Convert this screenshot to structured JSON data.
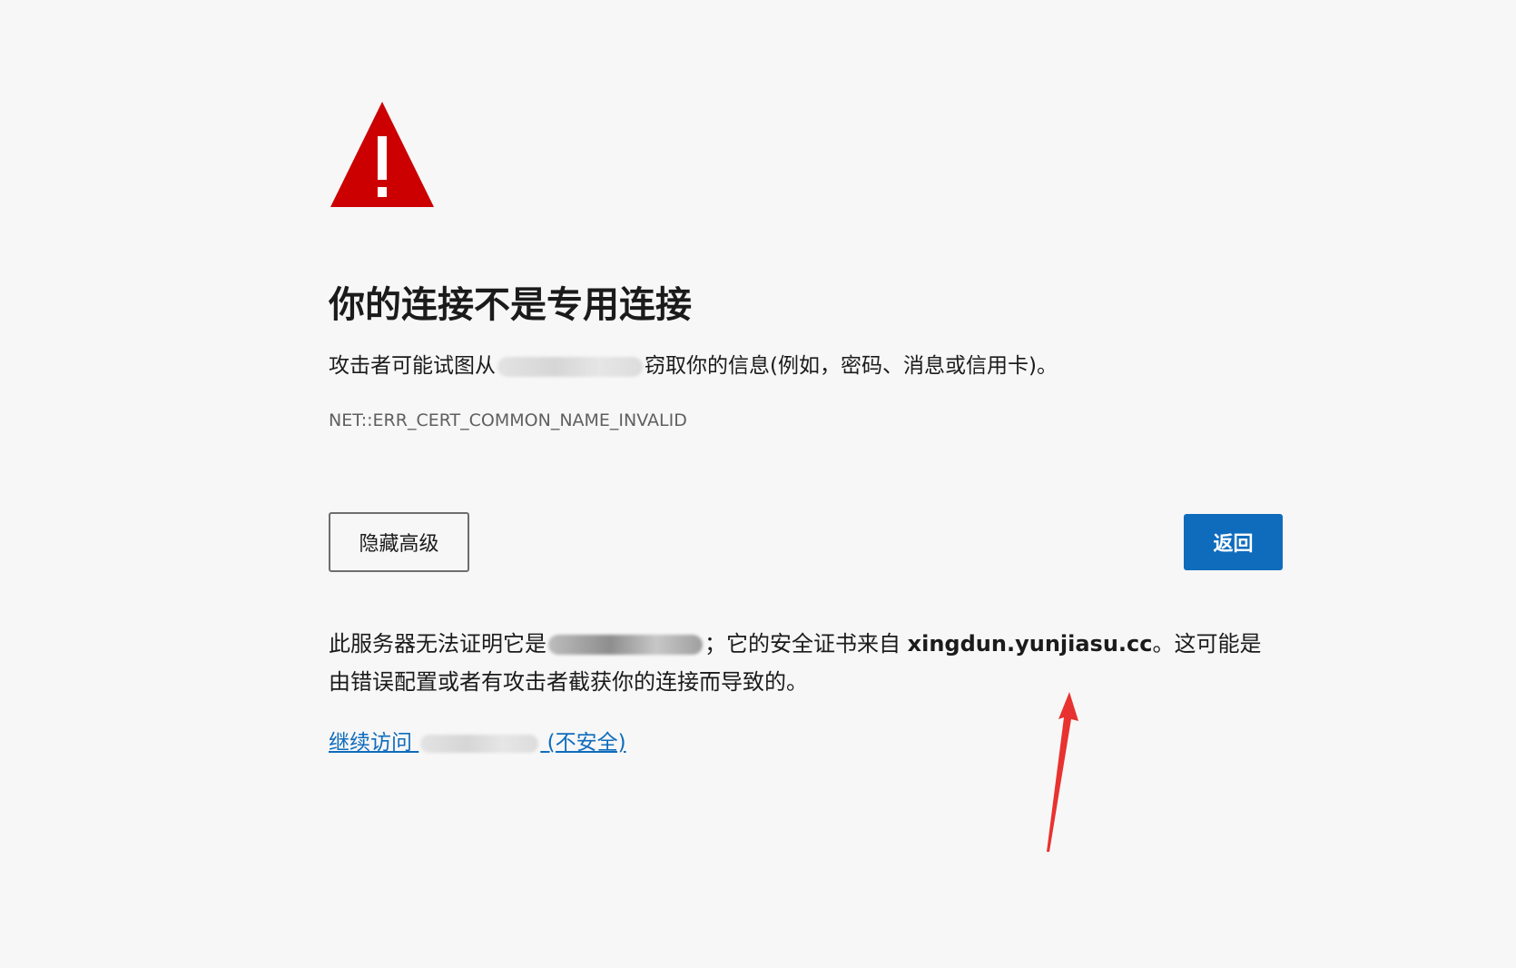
{
  "title": "你的连接不是专用连接",
  "description": {
    "prefix": "攻击者可能试图从",
    "suffix": "窃取你的信息(例如，密码、消息或信用卡)。"
  },
  "error_code": "NET::ERR_CERT_COMMON_NAME_INVALID",
  "buttons": {
    "advanced_label": "隐藏高级",
    "back_label": "返回"
  },
  "details": {
    "prefix": "此服务器无法证明它是",
    "middle": "；它的安全证书来自",
    "cert_domain": "xingdun.yunjiasu.cc",
    "suffix": "。这可能是由错误配置或者有攻击者截获你的连接而导致的。"
  },
  "proceed_link": {
    "prefix": "继续访问",
    "suffix": "(不安全)"
  },
  "colors": {
    "warning_red": "#cc0000",
    "primary_blue": "#0f6cbd",
    "annotation_red": "#e8322f",
    "background": "#f7f7f7"
  },
  "icons": {
    "warning": "warning-triangle-icon",
    "annotation": "annotation-arrow-icon"
  }
}
